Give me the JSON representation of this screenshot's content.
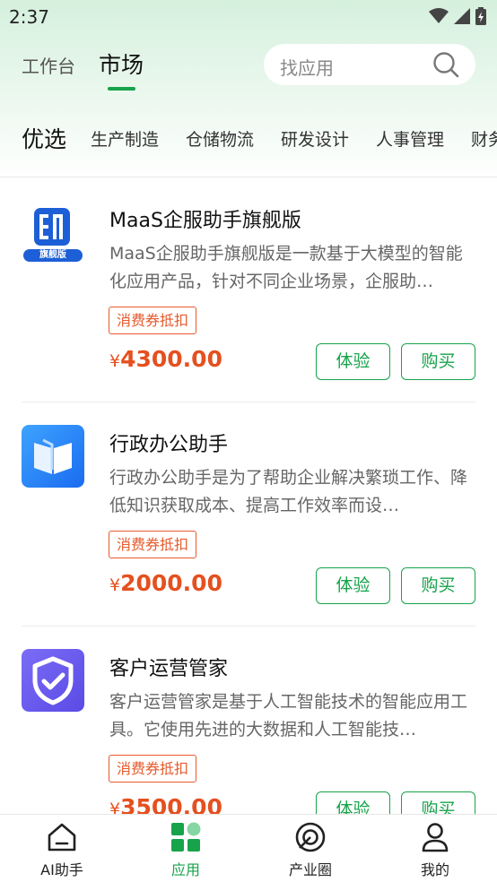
{
  "status_bar": {
    "time": "2:37"
  },
  "header": {
    "tabs": [
      {
        "label": "工作台",
        "active": false
      },
      {
        "label": "市场",
        "active": true
      }
    ],
    "search_placeholder": "找应用"
  },
  "categories": [
    "优选",
    "生产制造",
    "仓储物流",
    "研发设计",
    "人事管理",
    "财务"
  ],
  "products": [
    {
      "name": "MaaS企服助手旗舰版",
      "icon_badge": "旗舰版",
      "icon": "maas-logo-icon",
      "description": "MaaS企服助手旗舰版是一款基于大模型的智能化应用产品，针对不同企业场景，企服助…",
      "coupon": "消费券抵扣",
      "currency": "¥",
      "price": "4300.00",
      "try_label": "体验",
      "buy_label": "购买"
    },
    {
      "name": "行政办公助手",
      "icon": "book-icon",
      "description": "行政办公助手是为了帮助企业解决繁琐工作、降低知识获取成本、提高工作效率而设…",
      "coupon": "消费券抵扣",
      "currency": "¥",
      "price": "2000.00",
      "try_label": "体验",
      "buy_label": "购买"
    },
    {
      "name": "客户运营管家",
      "icon": "shield-check-icon",
      "description": "客户运营管家是基于人工智能技术的智能应用工具。它使用先进的大数据和人工智能技…",
      "coupon": "消费券抵扣",
      "currency": "¥",
      "price": "3500.00",
      "try_label": "体验",
      "buy_label": "购买"
    }
  ],
  "bottom_nav": [
    {
      "label": "AI助手",
      "icon": "home-icon",
      "active": false
    },
    {
      "label": "应用",
      "icon": "apps-grid-icon",
      "active": true
    },
    {
      "label": "产业圈",
      "icon": "target-icon",
      "active": false
    },
    {
      "label": "我的",
      "icon": "user-icon",
      "active": false
    }
  ],
  "colors": {
    "accent": "#16a34a",
    "price": "#e5501f",
    "coupon": "#e65a2b",
    "header_bg": "#d5f0dd"
  }
}
